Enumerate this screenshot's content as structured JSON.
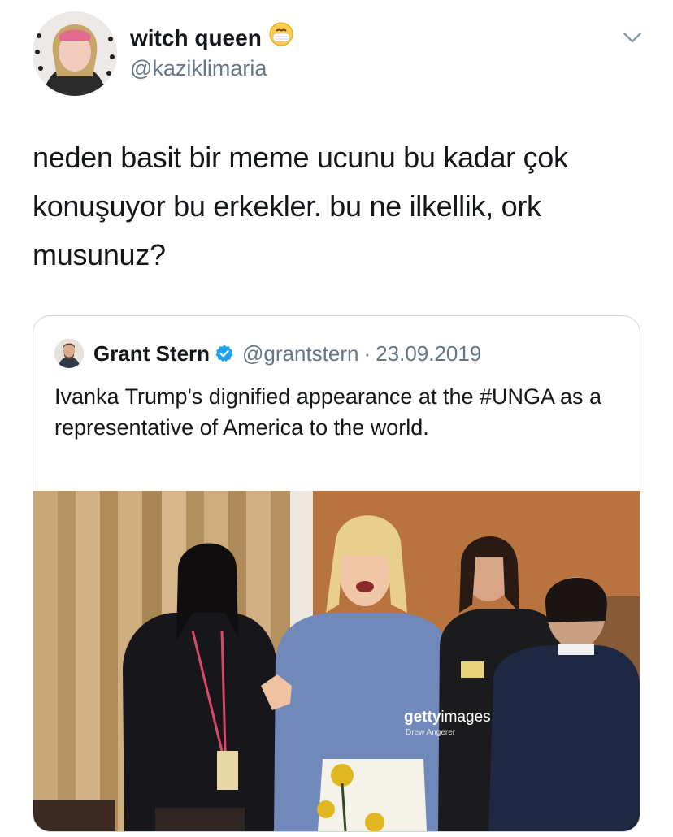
{
  "tweet": {
    "display_name": "witch queen",
    "emoji_icon": "face-with-medical-mask-icon",
    "handle": "@kaziklimaria",
    "menu_icon": "chevron-down-icon",
    "text": "neden basit bir meme ucunu bu kadar çok konuşuyor bu erkekler. bu ne ilkellik, ork musunuz?"
  },
  "quote": {
    "name": "Grant Stern",
    "verified_icon": "verified-badge-icon",
    "handle": "@grantstern",
    "separator": "·",
    "date": "23.09.2019",
    "text": "Ivanka Trump's dignified appearance at the #UNGA as a representative of America to the world.",
    "photo": {
      "watermark_bold": "getty",
      "watermark_rest": "images",
      "credit": "Drew Angerer"
    }
  },
  "colors": {
    "text_primary": "#14171a",
    "text_secondary": "#657786",
    "border": "#ccd6dd",
    "verified_blue": "#1da1f2"
  }
}
